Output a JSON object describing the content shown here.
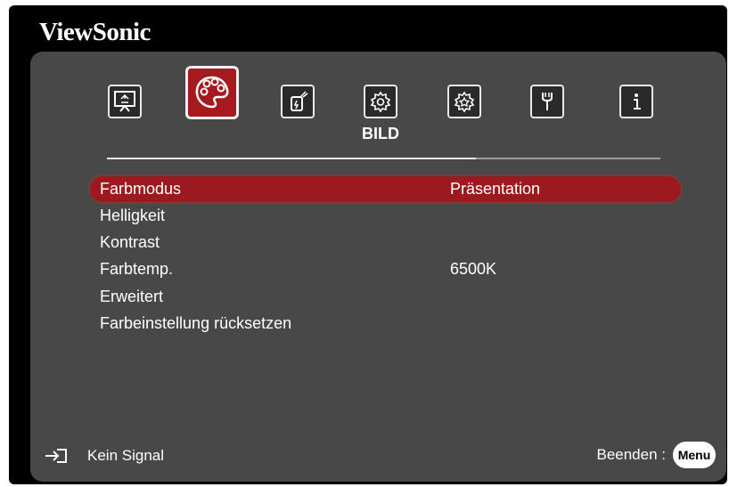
{
  "brand": "ViewSonic",
  "tabs": [
    {
      "icon": "display-icon"
    },
    {
      "icon": "palette-icon",
      "active": true
    },
    {
      "icon": "power-plug-icon"
    },
    {
      "icon": "gear-icon"
    },
    {
      "icon": "advanced-gear-icon"
    },
    {
      "icon": "wrench-icon"
    },
    {
      "icon": "info-icon"
    }
  ],
  "active_tab_title": "BILD",
  "menu": [
    {
      "label": "Farbmodus",
      "value": "Präsentation",
      "selected": true
    },
    {
      "label": "Helligkeit",
      "value": ""
    },
    {
      "label": "Kontrast",
      "value": ""
    },
    {
      "label": "Farbtemp.",
      "value": "6500K"
    },
    {
      "label": "Erweitert",
      "value": ""
    },
    {
      "label": "Farbeinstellung rücksetzen",
      "value": ""
    }
  ],
  "footer": {
    "source_icon": "input-source-icon",
    "status": "Kein Signal",
    "exit_label": "Beenden :",
    "menu_key": "Menu"
  },
  "colors": {
    "accent": "#a61a1f",
    "panel": "#484848",
    "frame": "#000000"
  }
}
